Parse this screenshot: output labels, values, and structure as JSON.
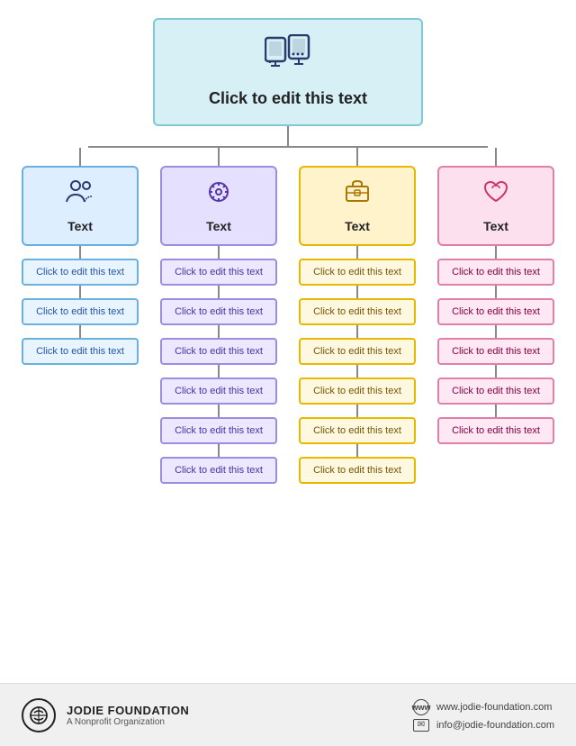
{
  "root": {
    "title": "Click to edit this text",
    "icon": "🖥️"
  },
  "columns": [
    {
      "id": "blue",
      "colorClass": "col-blue",
      "icon": "👥",
      "label": "Text",
      "children": [
        "Click to edit this text",
        "Click to edit this text",
        "Click to edit this text"
      ]
    },
    {
      "id": "purple",
      "colorClass": "col-purple",
      "icon": "⚙️",
      "label": "Text",
      "children": [
        "Click to edit this text",
        "Click to edit this text",
        "Click to edit this text",
        "Click to edit this text",
        "Click to edit this text",
        "Click to edit this text"
      ]
    },
    {
      "id": "yellow",
      "colorClass": "col-yellow",
      "icon": "💼",
      "label": "Text",
      "children": [
        "Click to edit this text",
        "Click to edit this text",
        "Click to edit this text",
        "Click to edit this text",
        "Click to edit this text",
        "Click to edit this text"
      ]
    },
    {
      "id": "pink",
      "colorClass": "col-pink",
      "icon": "🩷",
      "label": "Text",
      "children": [
        "Click to edit this text",
        "Click to edit this text",
        "Click to edit this text",
        "Click to edit this text",
        "Click to edit this text"
      ]
    }
  ],
  "footer": {
    "org_name": "JODIE FOUNDATION",
    "org_sub": "A Nonprofit Organization",
    "website": "www.jodie-foundation.com",
    "email": "info@jodie-foundation.com"
  }
}
